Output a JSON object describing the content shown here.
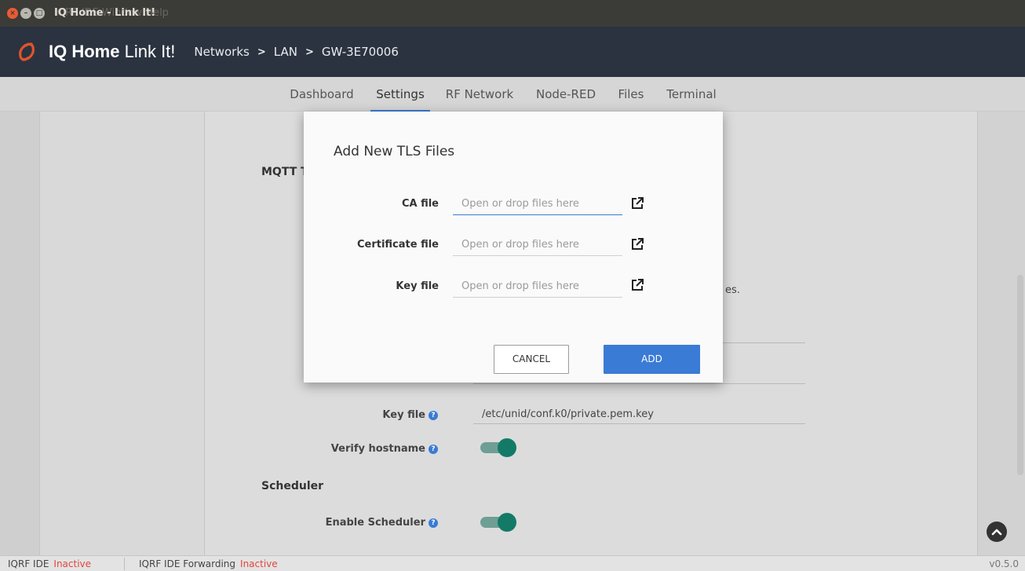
{
  "os": {
    "title": "IQ Home - Link It!",
    "menu_overlap": "IQRF IDE Window Help",
    "menu_help": "Help"
  },
  "header": {
    "brand_bold": "IQ Home",
    "brand_light": "Link It!",
    "breadcrumb": [
      "Networks",
      "LAN",
      "GW-3E70006"
    ],
    "sep": ">"
  },
  "tabs": [
    "Dashboard",
    "Settings",
    "RF Network",
    "Node-RED",
    "Files",
    "Terminal"
  ],
  "active_tab": "Settings",
  "background": {
    "mqtt_heading": "MQTT T",
    "partial_text": "es.",
    "key_file_label": "Key file",
    "key_file_value": "/etc/unid/conf.k0/private.pem.key",
    "verify_hostname_label": "Verify hostname",
    "verify_hostname_on": true,
    "scheduler_heading": "Scheduler",
    "enable_scheduler_label": "Enable Scheduler",
    "enable_scheduler_on": true
  },
  "modal": {
    "title": "Add New TLS Files",
    "rows": [
      {
        "label": "CA file",
        "placeholder": "Open or drop files here"
      },
      {
        "label": "Certificate file",
        "placeholder": "Open or drop files here"
      },
      {
        "label": "Key file",
        "placeholder": "Open or drop files here"
      }
    ],
    "cancel": "CANCEL",
    "add": "ADD"
  },
  "status": {
    "ide_label": "IQRF IDE",
    "ide_state": "Inactive",
    "fwd_label": "IQRF IDE Forwarding",
    "fwd_state": "Inactive",
    "version": "v0.5.0"
  },
  "colors": {
    "accent": "#3a7bd5",
    "header_bg": "#2b3340",
    "toggle_on": "#137a68",
    "inactive": "#e5453b"
  }
}
